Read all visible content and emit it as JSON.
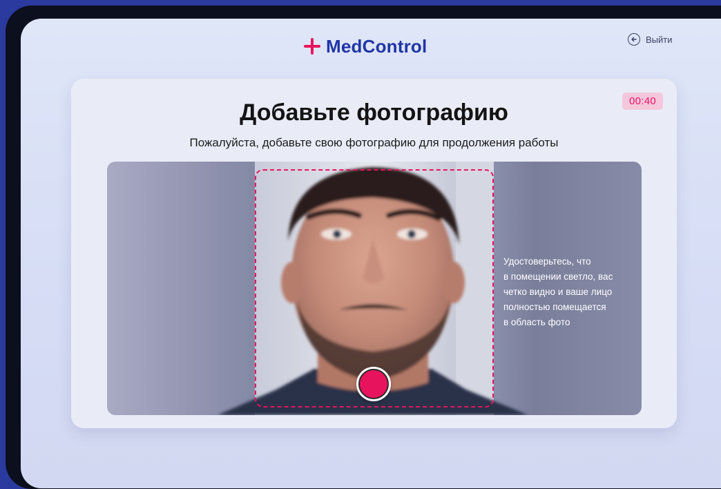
{
  "app": {
    "brand_name": "MedControl",
    "logout_label": "Выйти"
  },
  "card": {
    "timer": "00:40",
    "title": "Добавьте фотографию",
    "subtitle": "Пожалуйста, добавьте свою фотографию для продолжения работы"
  },
  "camera": {
    "hint_lines": [
      "Удостоверьтесь, что",
      "в помещении светло, вас",
      "четко видно и ваше лицо",
      "полностью помещается",
      "в область фото"
    ]
  },
  "colors": {
    "accent": "#e8135d",
    "brand": "#1f35a5"
  },
  "icons": {
    "logo": "plus-icon",
    "logout": "arrow-left-circle-icon",
    "shutter": "shutter-button"
  }
}
